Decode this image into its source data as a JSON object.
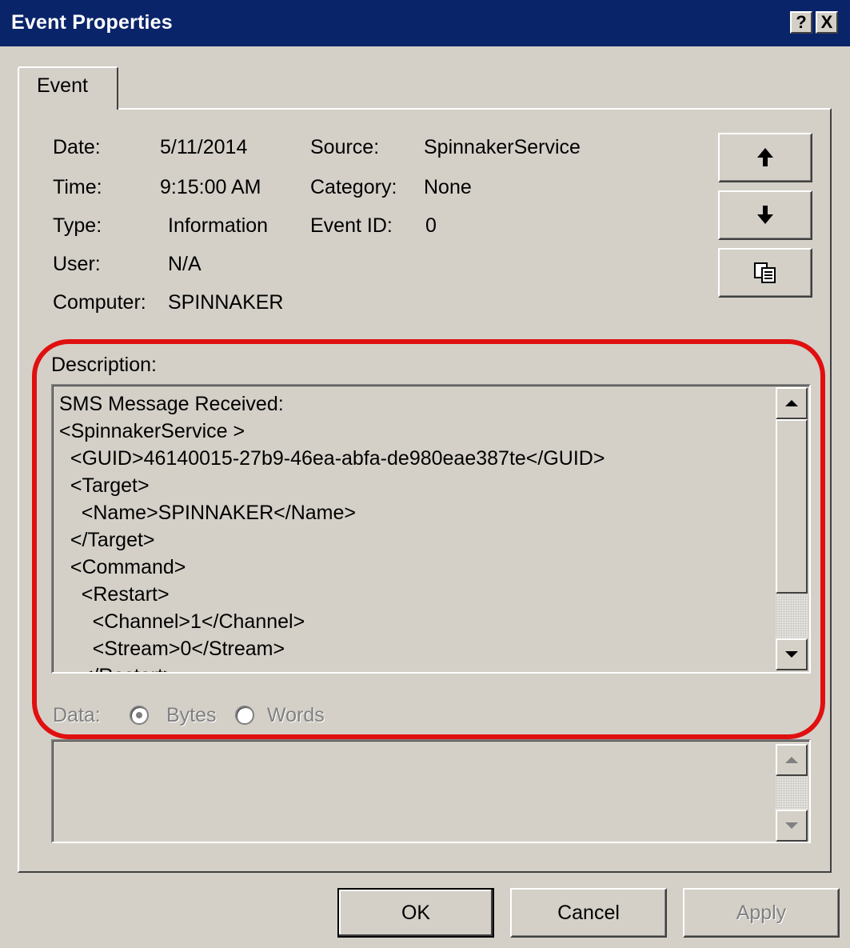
{
  "window": {
    "title": "Event Properties",
    "help_label": "?",
    "close_label": "X"
  },
  "tabs": [
    {
      "label": "Event",
      "active": true
    }
  ],
  "event": {
    "date_label": "Date:",
    "date_value": "5/11/2014",
    "time_label": "Time:",
    "time_value": "9:15:00 AM",
    "type_label": "Type:",
    "type_value": "Information",
    "user_label": "User:",
    "user_value": "N/A",
    "computer_label": "Computer:",
    "computer_value": "SPINNAKER",
    "source_label": "Source:",
    "source_value": "SpinnakerService",
    "category_label": "Category:",
    "category_value": "None",
    "event_id_label": "Event ID:",
    "event_id_value": "0"
  },
  "nav": {
    "up_icon": "arrow-up-icon",
    "down_icon": "arrow-down-icon",
    "copy_icon": "copy-icon"
  },
  "description": {
    "label": "Description:",
    "lines": [
      "SMS Message Received:",
      "<SpinnakerService >",
      "  <GUID>46140015-27b9-46ea-abfa-de980eae387te</GUID>",
      "  <Target>",
      "    <Name>SPINNAKER</Name>",
      "  </Target>",
      "  <Command>",
      "    <Restart>",
      "      <Channel>1</Channel>",
      "      <Stream>0</Stream>",
      "    </Restart>"
    ]
  },
  "data_section": {
    "label": "Data:",
    "options": [
      {
        "label": "Bytes",
        "selected": true
      },
      {
        "label": "Words",
        "selected": false
      }
    ]
  },
  "buttons": {
    "ok": "OK",
    "cancel": "Cancel",
    "apply": "Apply"
  },
  "colors": {
    "titlebar": "#0a246a",
    "dialog_face": "#d4d0c8",
    "highlight_outline": "#e01010",
    "disabled_text": "#808080"
  }
}
